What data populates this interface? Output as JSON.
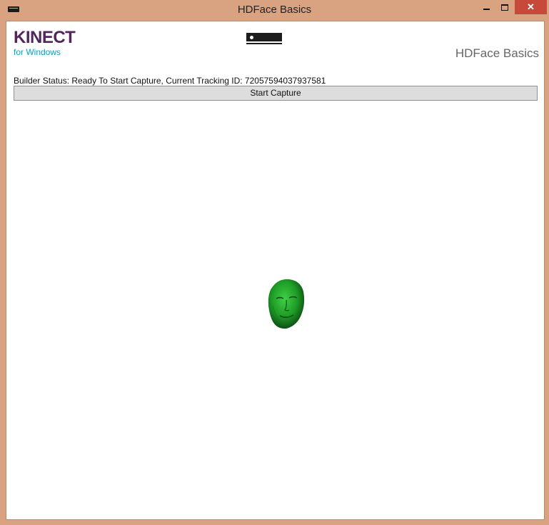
{
  "window": {
    "title": "HDFace Basics",
    "close_glyph": "✕"
  },
  "header": {
    "logo_main": "KINECT",
    "logo_sub": "for Windows",
    "app_title": "HDFace Basics",
    "sensor_icon": "kinect-sensor-icon"
  },
  "status": {
    "text": "Builder Status: Ready To Start Capture, Current Tracking ID: 72057594037937581"
  },
  "toolbar": {
    "capture_label": "Start Capture"
  },
  "colors": {
    "titlebar": "#d9a381",
    "brand_purple": "#52255d",
    "brand_cyan": "#00a3c4",
    "face_mesh": "#1fa32a"
  }
}
